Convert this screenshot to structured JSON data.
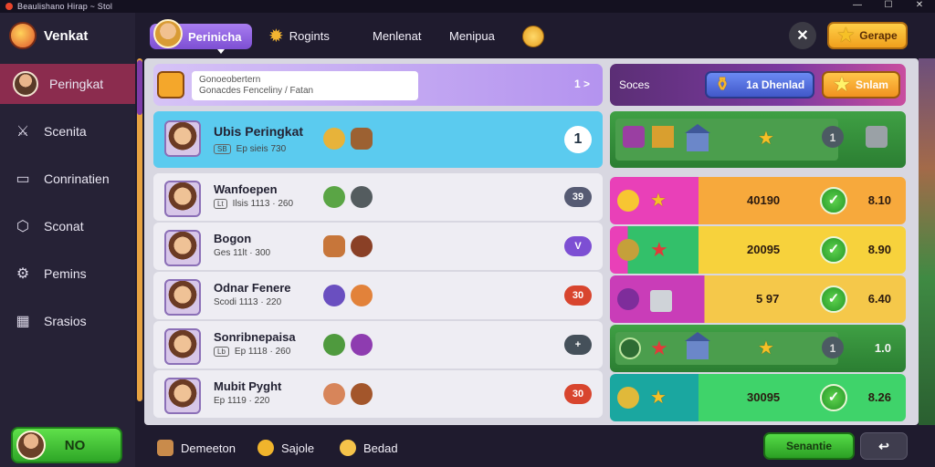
{
  "window": {
    "title": "Beaulishano  Hirap ~ Stol",
    "controls": [
      "—",
      "☐",
      "✕"
    ]
  },
  "sidebar": {
    "brand": "Venkat",
    "items": [
      {
        "label": "Peringkat",
        "icon": "avatar",
        "active": true
      },
      {
        "label": "Scenita",
        "icon": "swords-icon"
      },
      {
        "label": "Conrinatien",
        "icon": "monitor-icon"
      },
      {
        "label": "Sconat",
        "icon": "shield-icon"
      },
      {
        "label": "Pemins",
        "icon": "gear-icon"
      },
      {
        "label": "Srasios",
        "icon": "building-icon"
      }
    ],
    "bottom_button": "NO"
  },
  "topbar": {
    "tabs": [
      "Perinicha",
      "Rogints",
      "Menlenat",
      "Menipua"
    ],
    "daily_label": "Gerape",
    "close_symbol": "✕"
  },
  "search": {
    "line1": "Gonoeobertern",
    "line2": "Gonacdes Fenceliny / Fatan",
    "count": "1 >"
  },
  "rightbar": {
    "label": "Soces",
    "blue_label": "1a Dhenlad",
    "orange_label": "Snlam"
  },
  "rows": [
    {
      "name": "Ubis Peringkat",
      "tag": "SB",
      "meta": "Ep sieis 730",
      "pill": "1",
      "pill_bg": "#ffffff",
      "pill_fg": "#223344",
      "highlight": true
    },
    {
      "name": "Wanfoepen",
      "tag": "Lt",
      "meta": "Ilsis 1113 · 260",
      "pill": "39",
      "pill_bg": "#565b73",
      "pill_fg": "#ffffff"
    },
    {
      "name": "Bogon",
      "tag": "",
      "meta": "Ges 11lt · 300",
      "pill": "V",
      "pill_bg": "#7d4fd3",
      "pill_fg": "#ffffff"
    },
    {
      "name": "Odnar Fenere",
      "tag": "",
      "meta": "Scodi 1113 · 220",
      "pill": "30",
      "pill_bg": "#d8452e",
      "pill_fg": "#ffffff"
    },
    {
      "name": "Sonribnepaisa",
      "tag": "Lb",
      "meta": "Ep 1118 · 260",
      "pill": "+",
      "pill_bg": "#45505a",
      "pill_fg": "#ffffff"
    },
    {
      "name": "Mubit Pyght",
      "tag": "",
      "meta": "Ep 1119 · 220",
      "pill": "30",
      "pill_bg": "#d8452e",
      "pill_fg": "#ffffff"
    }
  ],
  "right_rows": [
    {
      "value": "",
      "score": "",
      "style": "green"
    },
    {
      "value": "40190",
      "score": "8.10",
      "style": "orange"
    },
    {
      "value": "20095",
      "score": "8.90",
      "style": "yellow"
    },
    {
      "value": "5 97",
      "score": "6.40",
      "style": "magenta"
    },
    {
      "value": "",
      "score": "1.0",
      "style": "green"
    },
    {
      "value": "30095",
      "score": "8.26",
      "style": "teal"
    }
  ],
  "bottombar": {
    "tabs": [
      "Demeeton",
      "Sajole",
      "Bedad"
    ],
    "green_button": "Senantie",
    "back_symbol": "↩"
  }
}
